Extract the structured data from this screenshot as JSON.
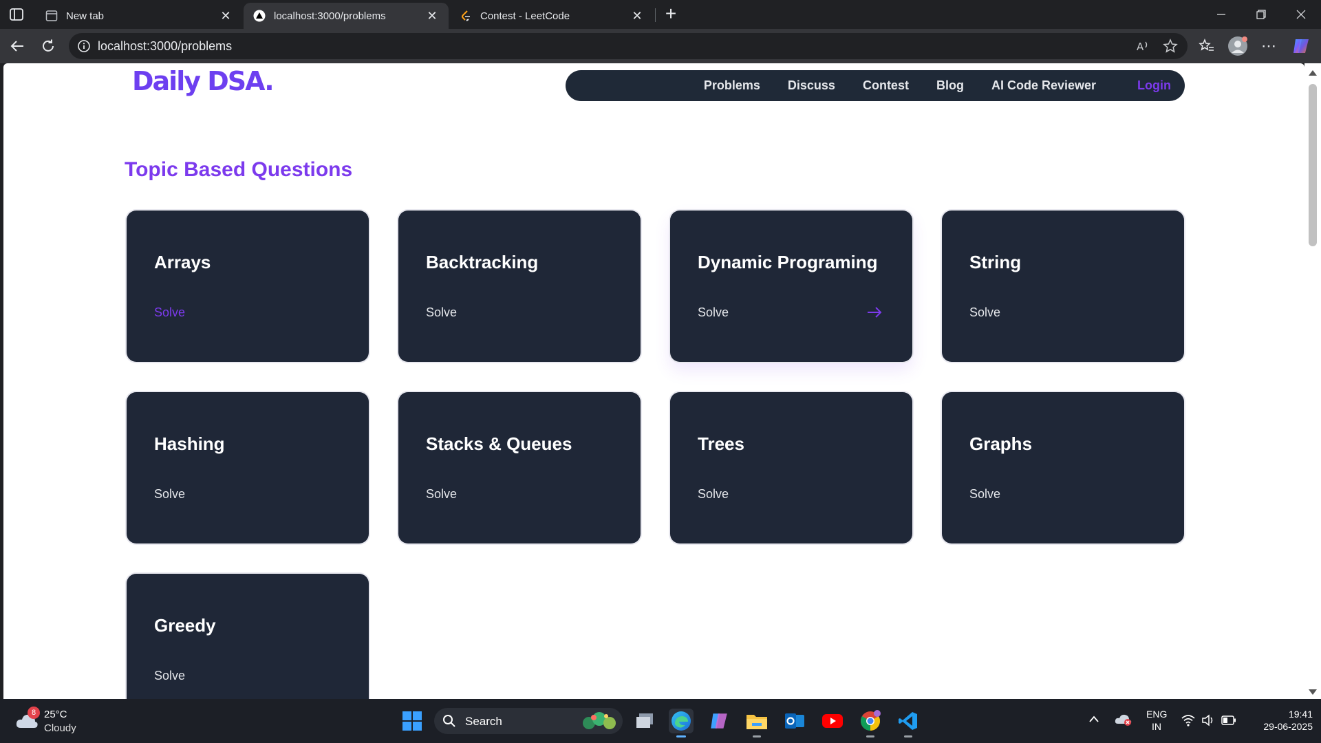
{
  "browser": {
    "tabs": [
      {
        "title": "New tab",
        "icon": "newtab-page-icon",
        "active": false
      },
      {
        "title": "localhost:3000/problems",
        "icon": "nextjs-icon",
        "active": true
      },
      {
        "title": "Contest - LeetCode",
        "icon": "leetcode-icon",
        "active": false
      }
    ],
    "url": "localhost:3000/problems"
  },
  "site": {
    "logo": "Daily DSA",
    "logo_dot": ".",
    "nav": {
      "problems": "Problems",
      "discuss": "Discuss",
      "contest": "Contest",
      "blog": "Blog",
      "ai_reviewer": "AI Code Reviewer",
      "login": "Login"
    },
    "section_title": "Topic Based Questions",
    "topics": [
      {
        "name": "Arrays",
        "action": "Solve"
      },
      {
        "name": "Backtracking",
        "action": "Solve"
      },
      {
        "name": "Dynamic Programing",
        "action": "Solve"
      },
      {
        "name": "String",
        "action": "Solve"
      },
      {
        "name": "Hashing",
        "action": "Solve"
      },
      {
        "name": "Stacks & Queues",
        "action": "Solve"
      },
      {
        "name": "Trees",
        "action": "Solve"
      },
      {
        "name": "Graphs",
        "action": "Solve"
      },
      {
        "name": "Greedy",
        "action": "Solve"
      }
    ],
    "colors": {
      "accent": "#7c3aed",
      "card": "#1f2737",
      "nav": "#1f2937"
    }
  },
  "taskbar": {
    "weather": {
      "badge": "8",
      "temp": "25°C",
      "desc": "Cloudy"
    },
    "search_label": "Search",
    "lang": {
      "line1": "ENG",
      "line2": "IN"
    },
    "clock": {
      "time": "19:41",
      "date": "29-06-2025"
    }
  }
}
